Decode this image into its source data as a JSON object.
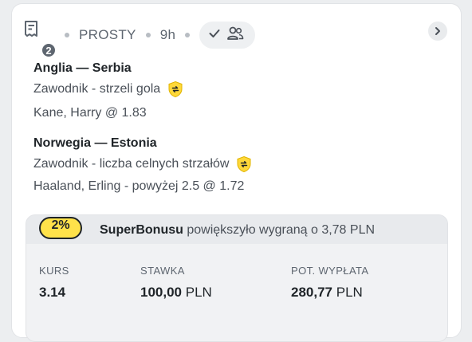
{
  "header": {
    "ticket_count": "2",
    "bet_type": "PROSTY",
    "time_ago": "9h",
    "check_icon": "check-icon",
    "users_icon": "users-icon",
    "next_icon": "chevron-right-icon"
  },
  "selections": [
    {
      "match": "Anglia — Serbia",
      "market": "Zawodnik - strzeli gola",
      "pick": "Kane, Harry @ 1.83",
      "badge_icon": "superbonus-shield-icon"
    },
    {
      "match": "Norwegia — Estonia",
      "market": "Zawodnik - liczba celnych strzałów",
      "pick": "Haaland, Erling - powyżej 2.5 @ 1.72",
      "badge_icon": "superbonus-shield-icon"
    }
  ],
  "bonus": {
    "percent": "2%",
    "name": "SuperBonusu",
    "text": "powiększyło wygraną o 3,78 PLN"
  },
  "summary": {
    "odds_label": "KURS",
    "odds_value": "3.14",
    "stake_label": "STAWKA",
    "stake_value": "100,00",
    "stake_currency": "PLN",
    "payout_label": "POT. WYPŁATA",
    "payout_value": "280,77",
    "payout_currency": "PLN"
  },
  "colors": {
    "accent_yellow": "#ffe24a",
    "text_dark": "#1f2428",
    "text_muted": "#5e6670"
  }
}
